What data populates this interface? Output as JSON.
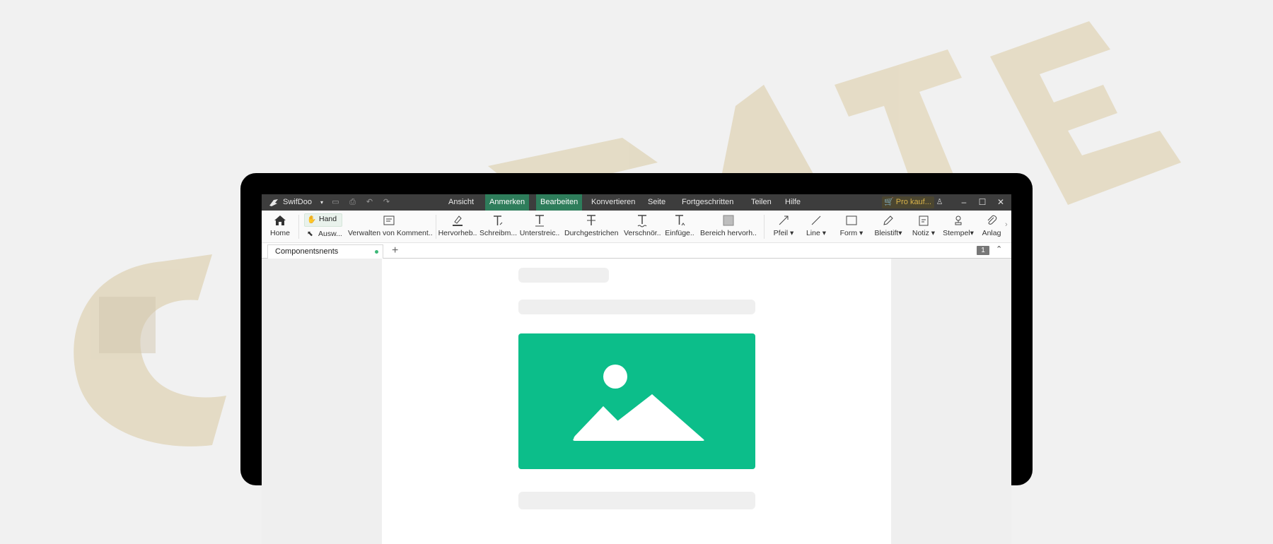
{
  "titlebar": {
    "app_name": "SwifDoo",
    "menu": [
      "Ansicht",
      "Anmerken",
      "Bearbeiten",
      "Konvertieren",
      "Seite",
      "Fortgeschritten",
      "Teilen",
      "Hilfe"
    ],
    "active_menu": [
      "Anmerken",
      "Bearbeiten"
    ],
    "pro_label": "Pro kauf..."
  },
  "toolbar": {
    "home": "Home",
    "hand": "Hand",
    "select": "Ausw...",
    "manage_comments": "Verwalten von Komment..",
    "tools": [
      {
        "label": "Hervorheb..",
        "icon": "highlighter-icon"
      },
      {
        "label": "Schreibm...",
        "icon": "typewriter-icon"
      },
      {
        "label": "Unterstreic..",
        "icon": "underline-icon"
      },
      {
        "label": "Durchgestrichen",
        "icon": "strikethrough-icon"
      },
      {
        "label": "Verschnör..",
        "icon": "squiggly-icon"
      },
      {
        "label": "Einfüge..",
        "icon": "insert-text-icon"
      },
      {
        "label": "Bereich hervorh..",
        "icon": "area-highlight-icon"
      }
    ],
    "tools2": [
      {
        "label": "Pfeil",
        "icon": "arrow-icon"
      },
      {
        "label": "Line",
        "icon": "line-icon"
      },
      {
        "label": "Form",
        "icon": "shape-icon"
      },
      {
        "label": "Bleistift",
        "icon": "pencil-icon"
      },
      {
        "label": "Notiz",
        "icon": "note-icon"
      },
      {
        "label": "Stempel",
        "icon": "stamp-icon"
      },
      {
        "label": "Anlag",
        "icon": "attachment-icon"
      }
    ]
  },
  "tabs": {
    "document_tab": "Componentsnents",
    "page_number": "1"
  },
  "colors": {
    "accent": "#2e7d5b",
    "image_placeholder": "#0cbe8a",
    "titlebar": "#3d3d3d"
  }
}
